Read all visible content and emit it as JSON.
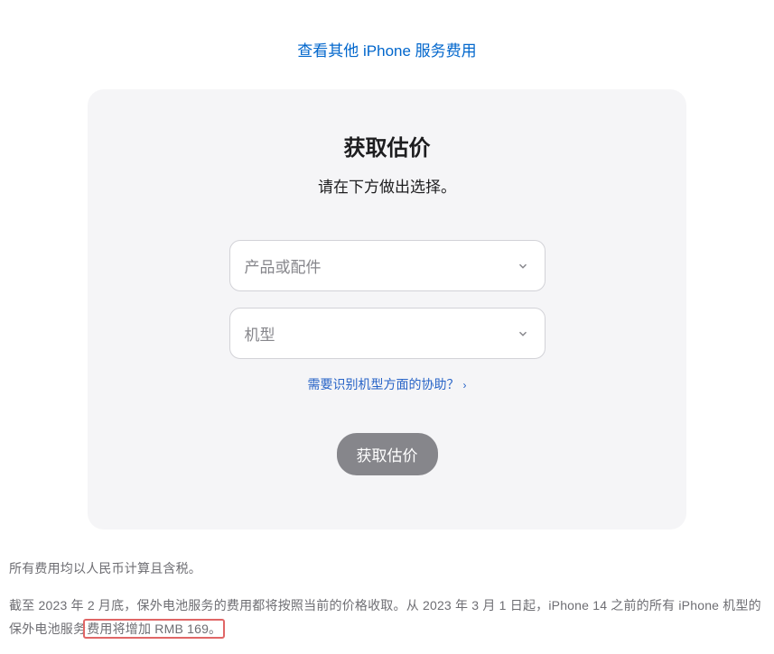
{
  "topLink": {
    "label": "查看其他 iPhone 服务费用"
  },
  "card": {
    "title": "获取估价",
    "subtitle": "请在下方做出选择。",
    "select1": {
      "placeholder": "产品或配件"
    },
    "select2": {
      "placeholder": "机型"
    },
    "helpLink": {
      "label": "需要识别机型方面的协助？"
    },
    "submitButton": {
      "label": "获取估价"
    }
  },
  "footer": {
    "line1": "所有费用均以人民币计算且含税。",
    "line2a": "截至 2023 年 2 月底，保外电池服务的费用都将按照当前的价格收取。从 2023 年 3 月 1 日起，iPhone 14 之前的所有 iPhone 机型的保外电池服务",
    "line2b": "费用将增加 RMB 169。"
  }
}
